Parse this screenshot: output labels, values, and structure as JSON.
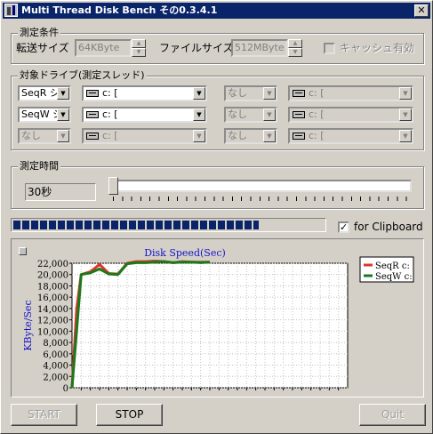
{
  "window": {
    "title": "Multi Thread Disk Bench その0.3.4.1",
    "close_label": "✕"
  },
  "conditions": {
    "group_label": "測定条件",
    "transfer_size_label": "転送サイズ",
    "transfer_size_value": "64KByte",
    "file_size_label": "ファイルサイズ",
    "file_size_value": "512MByte",
    "cache_label": "キャッシュ有効",
    "cache_checked": false
  },
  "drives": {
    "group_label": "対象ドライブ(測定スレッド)",
    "rows": [
      {
        "left_mode": "SeqR シ",
        "left_drive": "c: [",
        "right_mode": "なし",
        "right_drive": "c: ["
      },
      {
        "left_mode": "SeqW シ",
        "left_drive": "c: [",
        "right_mode": "なし",
        "right_drive": "c: ["
      },
      {
        "left_mode": "なし",
        "left_drive": "c: [",
        "right_mode": "なし",
        "right_drive": "c: ["
      }
    ]
  },
  "time": {
    "group_label": "測定時間",
    "value": "30秒",
    "slider_fraction": 0.0
  },
  "progress": {
    "fraction": 0.79
  },
  "clipboard": {
    "label": "for Clipboard",
    "checked": true
  },
  "buttons": {
    "start": "START",
    "stop": "STOP",
    "quit": "Quit"
  },
  "colors": {
    "seq_read": "#e0342c",
    "seq_write": "#1a7a1a",
    "chart_text": "#1414c8",
    "title_bar": "#0a246a"
  },
  "chart_data": {
    "type": "line",
    "title": "Disk Speed(Sec)",
    "xlabel": "",
    "ylabel": "KByte/Sec",
    "ylim": [
      0,
      22000
    ],
    "xlim": [
      0,
      30
    ],
    "yticks": [
      "22,000",
      "20,000",
      "18,000",
      "16,000",
      "14,000",
      "12,000",
      "10,000",
      "8,000",
      "6,000",
      "4,000",
      "2,000",
      "0"
    ],
    "grid": true,
    "legend": "top-right",
    "series": [
      {
        "name": "SeqR c:",
        "color": "#e0342c",
        "x": [
          0,
          0.5,
          1,
          2,
          3,
          4,
          5,
          6,
          7,
          8,
          9,
          10,
          11,
          12,
          13,
          14,
          15
        ],
        "y": [
          0,
          14000,
          20000,
          20500,
          21800,
          20200,
          20100,
          22000,
          22300,
          22300,
          22400,
          22300,
          22100,
          22300,
          22200,
          22200,
          22200
        ]
      },
      {
        "name": "SeqW c:",
        "color": "#1a7a1a",
        "x": [
          0,
          0.3,
          0.7,
          1,
          2,
          3,
          4,
          5,
          6,
          7,
          8,
          9,
          10,
          11,
          12,
          13,
          14,
          15
        ],
        "y": [
          0,
          6000,
          14000,
          20000,
          20300,
          21000,
          20100,
          20000,
          21900,
          22100,
          22100,
          22200,
          22300,
          22100,
          22200,
          22200,
          22100,
          22200
        ]
      }
    ]
  }
}
